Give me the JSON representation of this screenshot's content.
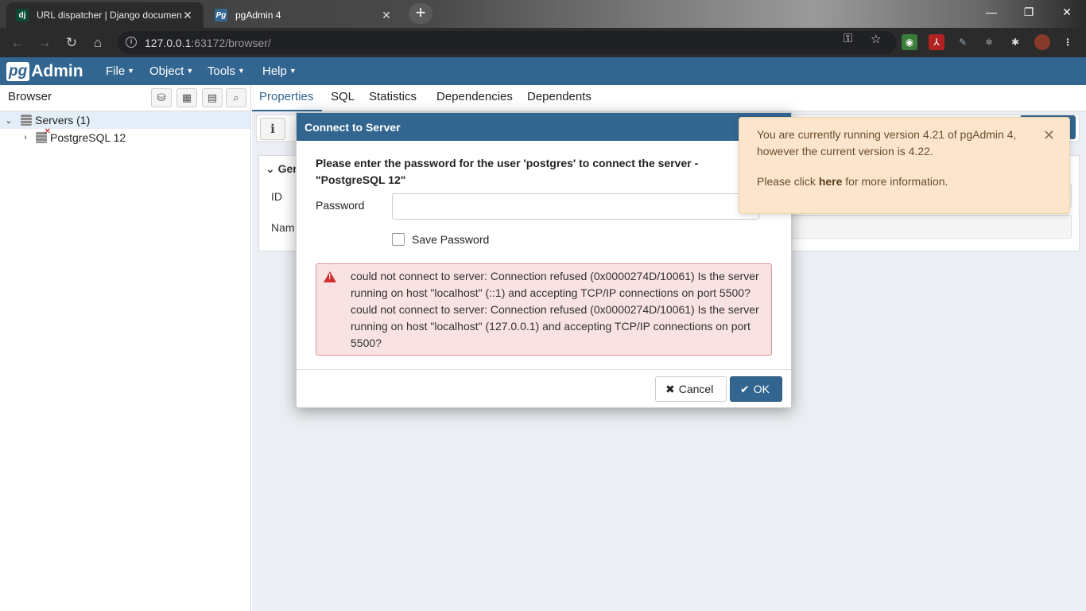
{
  "chrome": {
    "tabs": [
      {
        "favicon": "dj",
        "title": "URL dispatcher | Django documentation",
        "active": false
      },
      {
        "favicon": "Pg",
        "title": "pgAdmin 4",
        "active": true
      }
    ],
    "url_host": "127.0.0.1",
    "url_rest": ":63172/browser/",
    "icons": [
      "back-icon",
      "forward-icon",
      "reload-icon",
      "home-icon",
      "info-icon",
      "key-icon",
      "star-icon",
      "extensions-icon",
      "menu-icon"
    ]
  },
  "pgadmin": {
    "logo_pg": "pg",
    "logo_admin": "Admin",
    "menus": [
      "File",
      "Object",
      "Tools",
      "Help"
    ],
    "accent": "#326690"
  },
  "browser": {
    "title": "Browser",
    "tree": [
      {
        "label": "Servers (1)",
        "expanded": true
      },
      {
        "label": "PostgreSQL 12",
        "expanded": false
      }
    ]
  },
  "main": {
    "tabs": [
      "Properties",
      "SQL",
      "Statistics",
      "Dependencies",
      "Dependents"
    ],
    "general_label": "Ger",
    "fields": [
      "ID",
      "Nam"
    ]
  },
  "dialog": {
    "title": "Connect to Server",
    "prompt": "Please enter the password for the user 'postgres' to connect the server - \"PostgreSQL 12\"",
    "password_label": "Password",
    "password_value": "",
    "save_password_label": "Save Password",
    "save_password_checked": false,
    "error": "could not connect to server: Connection refused (0x0000274D/10061) Is the server running on host \"localhost\" (::1) and accepting TCP/IP connections on port 5500? could not connect to server: Connection refused (0x0000274D/10061) Is the server running on host \"localhost\" (127.0.0.1) and accepting TCP/IP connections on port 5500?",
    "cancel_label": "Cancel",
    "ok_label": "OK"
  },
  "notification": {
    "line1": "You are currently running version 4.21 of pgAdmin 4,",
    "line2": "however the current version is 4.22.",
    "line3_pre": "Please click",
    "line3_link": "here",
    "line3_post": "for more information."
  }
}
